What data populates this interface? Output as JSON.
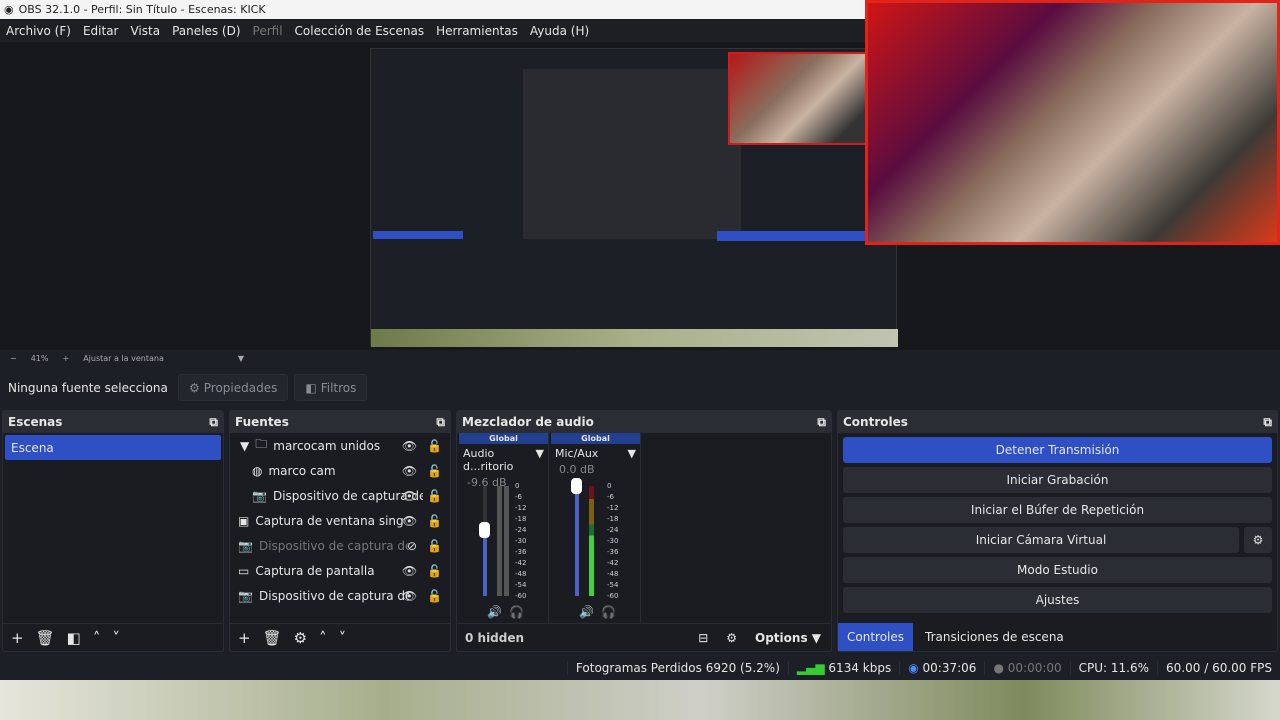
{
  "window_title": "OBS 32.1.0 - Perfil: Sin Título - Escenas: KICK",
  "menu": [
    "Archivo (F)",
    "Editar",
    "Vista",
    "Paneles (D)",
    "Perfil",
    "Colección de Escenas",
    "Herramientas",
    "Ayuda (H)"
  ],
  "zoom": {
    "minus": "−",
    "level": "41%",
    "plus": "+",
    "fit": "Ajustar a la ventana"
  },
  "source_bar": {
    "status": "Ninguna fuente selecciona",
    "properties": "Propiedades",
    "filters": "Filtros"
  },
  "scenes": {
    "title": "Escenas",
    "items": [
      "Escena"
    ]
  },
  "sources": {
    "title": "Fuentes",
    "items": [
      {
        "name": "marcocam unidos",
        "icon": "folder-icon",
        "indent": 0,
        "visible": true
      },
      {
        "name": "marco cam",
        "icon": "globe-icon",
        "indent": 1,
        "visible": true
      },
      {
        "name": "Dispositivo de captura de v",
        "icon": "camera-icon",
        "indent": 1,
        "visible": true
      },
      {
        "name": "Captura de ventana singular",
        "icon": "window-icon",
        "indent": 0,
        "visible": true
      },
      {
        "name": "Dispositivo de captura de vid",
        "icon": "camera-icon",
        "indent": 0,
        "visible": false
      },
      {
        "name": "Captura de pantalla",
        "icon": "monitor-icon",
        "indent": 0,
        "visible": true
      },
      {
        "name": "Dispositivo de captura de vid",
        "icon": "camera-icon",
        "indent": 0,
        "visible": true
      }
    ]
  },
  "mixer": {
    "title": "Mezclador de audio",
    "hidden": "0 hidden",
    "options": "Options",
    "channels": [
      {
        "tag": "Global",
        "name": "Audio d...ritorio",
        "db": "-9.6 dB",
        "muted": true,
        "volume": 0.6
      },
      {
        "tag": "Global",
        "name": "Mic/Aux",
        "db": "0.0 dB",
        "muted": false,
        "volume": 1.0
      }
    ],
    "scale": [
      "0",
      "-6",
      "-12",
      "-18",
      "-24",
      "-30",
      "-36",
      "-42",
      "-48",
      "-54",
      "-60"
    ]
  },
  "controls": {
    "title": "Controles",
    "buttons": [
      "Detener Transmisión",
      "Iniciar Grabación",
      "Iniciar el Búfer de Repetición",
      "Iniciar Cámara Virtual",
      "Modo Estudio",
      "Ajustes"
    ],
    "tabs": [
      "Controles",
      "Transiciones de escena"
    ]
  },
  "status": {
    "dropped": "Fotogramas Perdidos 6920 (5.2%)",
    "bitrate": "6134 kbps",
    "stream_time": "00:37:06",
    "rec_time": "00:00:00",
    "cpu": "CPU: 11.6%",
    "fps": "60.00 / 60.00 FPS"
  },
  "colors": {
    "accent": "#2f4fc4",
    "panel": "#1b1c22",
    "header": "#2b2d35"
  }
}
